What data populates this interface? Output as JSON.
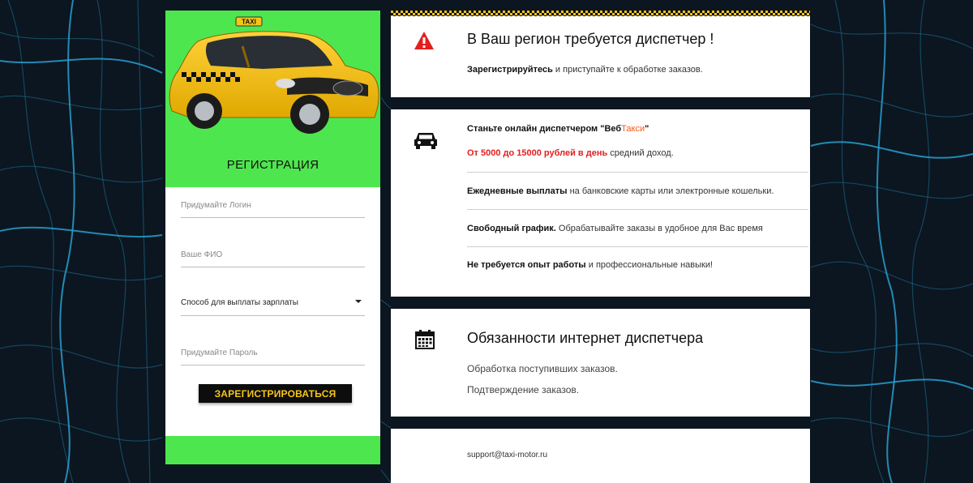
{
  "registration": {
    "title": "РЕГИСТРАЦИЯ",
    "login_placeholder": "Придумайте Логин",
    "fio_placeholder": "Ваше ФИО",
    "payment_select_value": "Способ для выплаты зарплаты",
    "password_placeholder": "Придумайте Пароль",
    "submit_label": "ЗАРЕГИСТРИРОВАТЬСЯ",
    "car_sign": "TAXI"
  },
  "card1": {
    "icon": "warning-icon",
    "heading": "В Ваш регион требуется диспетчер !",
    "line_bold": "Зарегистрируйтесь",
    "line_rest": " и приступайте к обработке заказов."
  },
  "card2": {
    "icon": "car-icon",
    "line1_prefix": "Станьте онлайн диспетчером \"Веб",
    "line1_accent": "Такси",
    "line1_suffix": "\"",
    "line2_accent": "От 5000 до 15000 рублей в день",
    "line2_rest": " средний доход.",
    "line3_bold": "Ежедневные выплаты",
    "line3_rest": " на банковские карты или электронные кошельки.",
    "line4_bold": "Свободный график.",
    "line4_rest": " Обрабатывайте заказы в удобное для Вас время",
    "line5_bold": "Не требуется опыт работы",
    "line5_rest": " и профессиональные навыки!"
  },
  "card3": {
    "icon": "calendar-icon",
    "heading": "Обязанности интернет диспетчера",
    "item1": "Обработка поступивших заказов.",
    "item2": "Подтверждение заказов."
  },
  "card4": {
    "email": "support@taxi-motor.ru"
  },
  "colors": {
    "background": "#0b1620",
    "map_roads": "#1f86b0",
    "green": "#4ee64e",
    "taxi_yellow": "#f5c518",
    "accent_red": "#e51d1d",
    "accent_orange": "#f05a1a"
  }
}
